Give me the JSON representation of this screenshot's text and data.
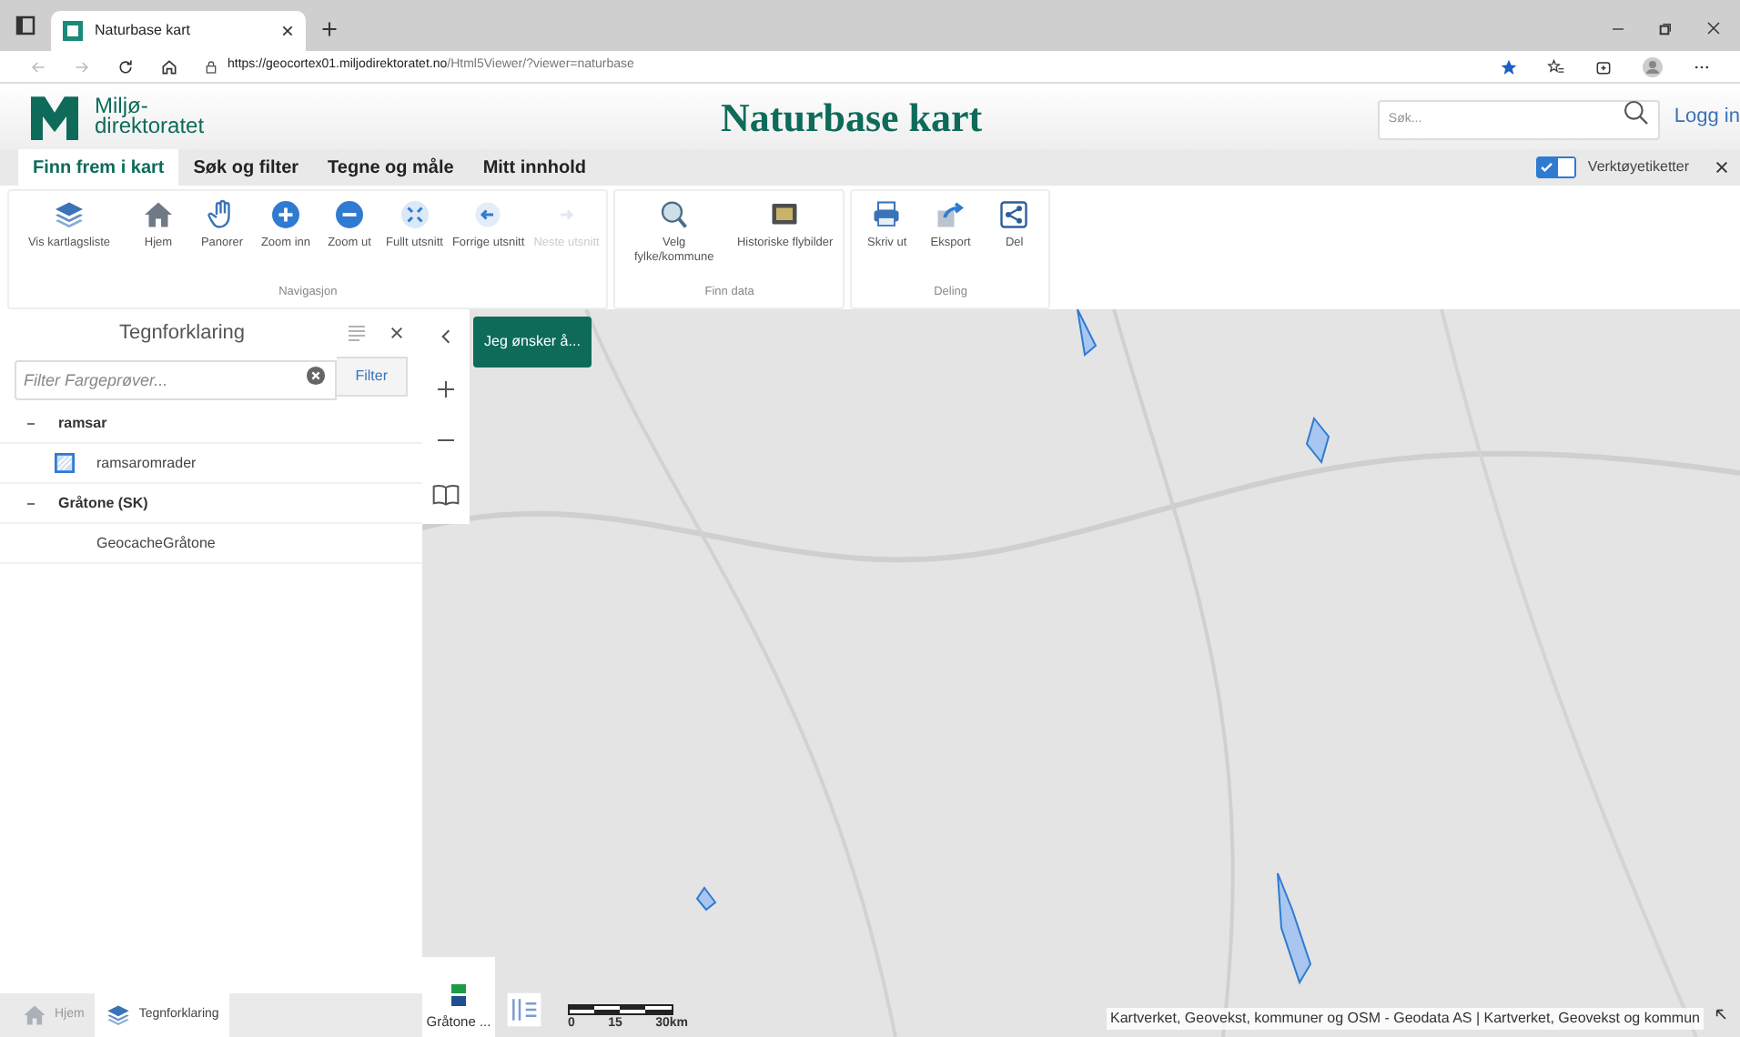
{
  "browser": {
    "tab_title": "Naturbase kart",
    "url_host": "https://geocortex01.miljodirektoratet.no",
    "url_path": "/Html5Viewer/?viewer=naturbase"
  },
  "header": {
    "logo_lines": [
      "Miljø-",
      "direktoratet"
    ],
    "title": "Naturbase kart",
    "search_placeholder": "Søk...",
    "login": "Logg in"
  },
  "ribbon_tabs": [
    {
      "label": "Finn frem i kart",
      "selected": true
    },
    {
      "label": "Søk og filter",
      "selected": false
    },
    {
      "label": "Tegne og måle",
      "selected": false
    },
    {
      "label": "Mitt innhold",
      "selected": false
    }
  ],
  "tool_labels_toggle": {
    "label": "Verktøyetiketter",
    "checked": true
  },
  "ribbon_groups": [
    {
      "name": "Navigasjon",
      "tools": [
        {
          "kind": "layers",
          "label": "Vis kartlagsliste",
          "disabled": false
        },
        {
          "kind": "home",
          "label": "Hjem",
          "disabled": false
        },
        {
          "kind": "hand",
          "label": "Panorer",
          "disabled": false
        },
        {
          "kind": "plus",
          "label": "Zoom inn",
          "disabled": false
        },
        {
          "kind": "minus",
          "label": "Zoom ut",
          "disabled": false
        },
        {
          "kind": "extent",
          "label": "Fullt utsnitt",
          "disabled": false
        },
        {
          "kind": "back",
          "label": "Forrige utsnitt",
          "disabled": false
        },
        {
          "kind": "forward",
          "label": "Neste utsnitt",
          "disabled": true
        }
      ]
    },
    {
      "name": "Finn data",
      "tools": [
        {
          "kind": "globe",
          "label": "Velg fylke/kommune",
          "disabled": false
        },
        {
          "kind": "photo",
          "label": "Historiske flybilder",
          "disabled": false
        }
      ]
    },
    {
      "name": "Deling",
      "tools": [
        {
          "kind": "print",
          "label": "Skriv ut",
          "disabled": false
        },
        {
          "kind": "export",
          "label": "Eksport",
          "disabled": false
        },
        {
          "kind": "share",
          "label": "Del",
          "disabled": false
        }
      ]
    }
  ],
  "legend": {
    "title": "Tegnforklaring",
    "filter_placeholder": "Filter Fargeprøver...",
    "filter_button": "Filter",
    "groups": [
      {
        "name": "ramsar",
        "expanded": true,
        "items": [
          {
            "label": "ramsaromrader",
            "swatch": true
          }
        ]
      },
      {
        "name": "Gråtone (SK)",
        "expanded": true,
        "items": [
          {
            "label": "GeocacheGråtone",
            "swatch": false
          }
        ]
      }
    ]
  },
  "bottom_tabs": [
    {
      "kind": "home",
      "label": "Hjem",
      "selected": false
    },
    {
      "kind": "layers",
      "label": "Tegnforklaring",
      "selected": true
    }
  ],
  "map": {
    "action_button": "Jeg ønsker å...",
    "basemap_label": "Gråtone ...",
    "scale_labels": [
      "0",
      "15",
      "30km"
    ],
    "attribution": "Kartverket, Geovekst, kommuner og OSM - Geodata AS | Kartverket, Geovekst og kommun"
  }
}
